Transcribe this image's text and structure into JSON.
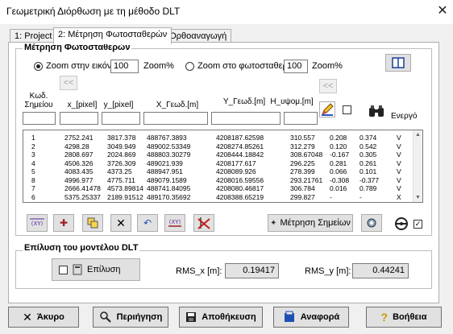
{
  "window": {
    "title": "Γεωμετρική Διόρθωση με τη μέθοδο DLT",
    "close_glyph": "✕"
  },
  "tabs": [
    {
      "label": "1: Project"
    },
    {
      "label": "2: Μέτρηση Φωτοσταθερών"
    },
    {
      "label": "3: Ορθοαναγωγή"
    }
  ],
  "measure_group": {
    "title": "Μέτρηση Φωτοσταθερών",
    "zoom_image_label": "Zoom στην εικόνα",
    "zoom_image_value": "100",
    "zoom_image_unit": "Zoom%",
    "zoom_point_label": "Zoom στο φωτοσταθερό",
    "zoom_point_value": "100",
    "zoom_point_unit": "Zoom%",
    "prev_left": "<<",
    "prev_right": "<<"
  },
  "columns": {
    "code": "Κωδ. Σημείου",
    "x_px": "x_[pixel]",
    "y_px": "y_[pixel]",
    "X": "X_Γεωδ.[m]",
    "Y": "Y_Γεωδ.[m]",
    "H": "H_υψομ.[m]",
    "active": "Ενεργό"
  },
  "rows": [
    [
      "1",
      "2752.241",
      "3817.378",
      "488767.3893",
      "4208187.62598",
      "310.557",
      "0.208",
      "0.374",
      "V"
    ],
    [
      "2",
      "4298.28",
      "3049.949",
      "489002.53349",
      "4208274.85261",
      "312.279",
      "0.120",
      "0.542",
      "V"
    ],
    [
      "3",
      "2808.697",
      "2024.869",
      "488803.30279",
      "4208444.18842",
      "308.67048",
      "-0.167",
      "0.305",
      "V"
    ],
    [
      "4",
      "4506.326",
      "3726.309",
      "489021.939",
      "4208177.617",
      "296.225",
      "0.281",
      "0.261",
      "V"
    ],
    [
      "5",
      "4083.435",
      "4373.25",
      "488947.951",
      "4208089.926",
      "278.399",
      "0.066",
      "0.101",
      "V"
    ],
    [
      "8",
      "4996.977",
      "4775.711",
      "489079.1589",
      "4208016.59556",
      "293.21761",
      "-0.308",
      "-0.377",
      "V"
    ],
    [
      "7",
      "2666.41478",
      "4573.89814",
      "488741.84095",
      "4208080.46817",
      "306.784",
      "0.016",
      "0.789",
      "V"
    ],
    [
      "6",
      "5375.25337",
      "2189.91512",
      "489170.35692",
      "4208388.65219",
      "299.827",
      "-",
      "-",
      "X"
    ]
  ],
  "toolbar": {
    "measure_points_label": "Μέτρηση Σημείων",
    "xy_label": "(XY)"
  },
  "dlt_group": {
    "title": "Επίλυση του μοντέλου DLT",
    "solve_label": "Επίλυση",
    "rms_x_label": "RMS_x [m]:",
    "rms_x_value": "0.19417",
    "rms_y_label": "RMS_y [m]:",
    "rms_y_value": "0.44241"
  },
  "buttons": {
    "cancel": "Άκυρο",
    "navigate": "Περιήγηση",
    "save": "Αποθήκευση",
    "report": "Αναφορά",
    "help": "Βοήθεια"
  },
  "colors": {
    "accent": "#0a5bc4",
    "window_bg": "#f0f0f0",
    "pane_bg": "#ffffff"
  }
}
